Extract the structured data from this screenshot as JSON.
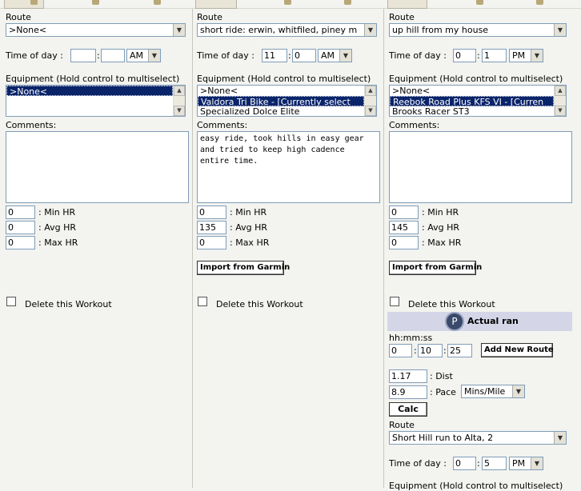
{
  "columns": [
    {
      "route_label": "Route",
      "route_value": ">None<",
      "time_label": "Time of day :",
      "time_hour": "",
      "time_minute": "",
      "time_ampm": "AM",
      "equipment_label": "Equipment (Hold control to multiselect)",
      "equipment_options": [
        ">None<"
      ],
      "comments_label": "Comments:",
      "comments": "",
      "min_hr": "0",
      "avg_hr": "0",
      "max_hr": "0",
      "min_hr_label": ": Min HR",
      "avg_hr_label": ": Avg HR",
      "max_hr_label": ": Max HR",
      "delete_label": "Delete this Workout"
    },
    {
      "route_label": "Route",
      "route_value": "short ride: erwin, whitfiled, piney m",
      "time_label": "Time of day :",
      "time_hour": "11",
      "time_minute": "0",
      "time_ampm": "AM",
      "equipment_label": "Equipment (Hold control to multiselect)",
      "equipment_options": [
        ">None<",
        "Valdora Tri Bike - [Currently select",
        "Specialized Dolce Elite"
      ],
      "comments_label": "Comments:",
      "comments": "easy ride, took hills in easy gear and tried to keep high cadence entire time.",
      "min_hr": "0",
      "avg_hr": "135",
      "max_hr": "0",
      "min_hr_label": ": Min HR",
      "avg_hr_label": ": Avg HR",
      "max_hr_label": ": Max HR",
      "import_label": "Import from Garmin",
      "delete_label": "Delete this Workout"
    },
    {
      "route_label": "Route",
      "route_value": "up hill from my house",
      "time_label": "Time of day :",
      "time_hour": "0",
      "time_minute": "1",
      "time_ampm": "PM",
      "equipment_label": "Equipment (Hold control to multiselect)",
      "equipment_options": [
        ">None<",
        "Reebok Road Plus KFS VI - [Curren",
        "Brooks Racer ST3"
      ],
      "comments_label": "Comments:",
      "comments": "",
      "min_hr": "0",
      "avg_hr": "145",
      "max_hr": "0",
      "min_hr_label": ": Min HR",
      "avg_hr_label": ": Avg HR",
      "max_hr_label": ": Max HR",
      "import_label": "Import from Garmin",
      "delete_label": "Delete this Workout",
      "actual": {
        "title": "Actual ran",
        "hms_label": "hh:mm:ss",
        "hh": "0",
        "mm": "10",
        "ss": "25",
        "add_route_label": "Add New Route",
        "dist_value": "1.17",
        "dist_label": ": Dist",
        "pace_value": "8.9",
        "pace_label": ": Pace",
        "pace_unit": "Mins/Mile",
        "calc_label": "Calc",
        "route_label": "Route",
        "route_value": "Short Hill run to Alta, 2",
        "time_label": "Time of day :",
        "time_hour": "0",
        "time_minute": "5",
        "time_ampm": "PM",
        "equipment_label": "Equipment (Hold control to multiselect)"
      }
    }
  ],
  "icons": {
    "dropdown": "▼",
    "up": "▲",
    "down": "▼",
    "actual_icon": "P"
  },
  "colors": {
    "selection": "#0a246a",
    "input_border": "#7f9db9",
    "background": "#f3f3ef",
    "actual_bar": "#d4d6e8"
  }
}
